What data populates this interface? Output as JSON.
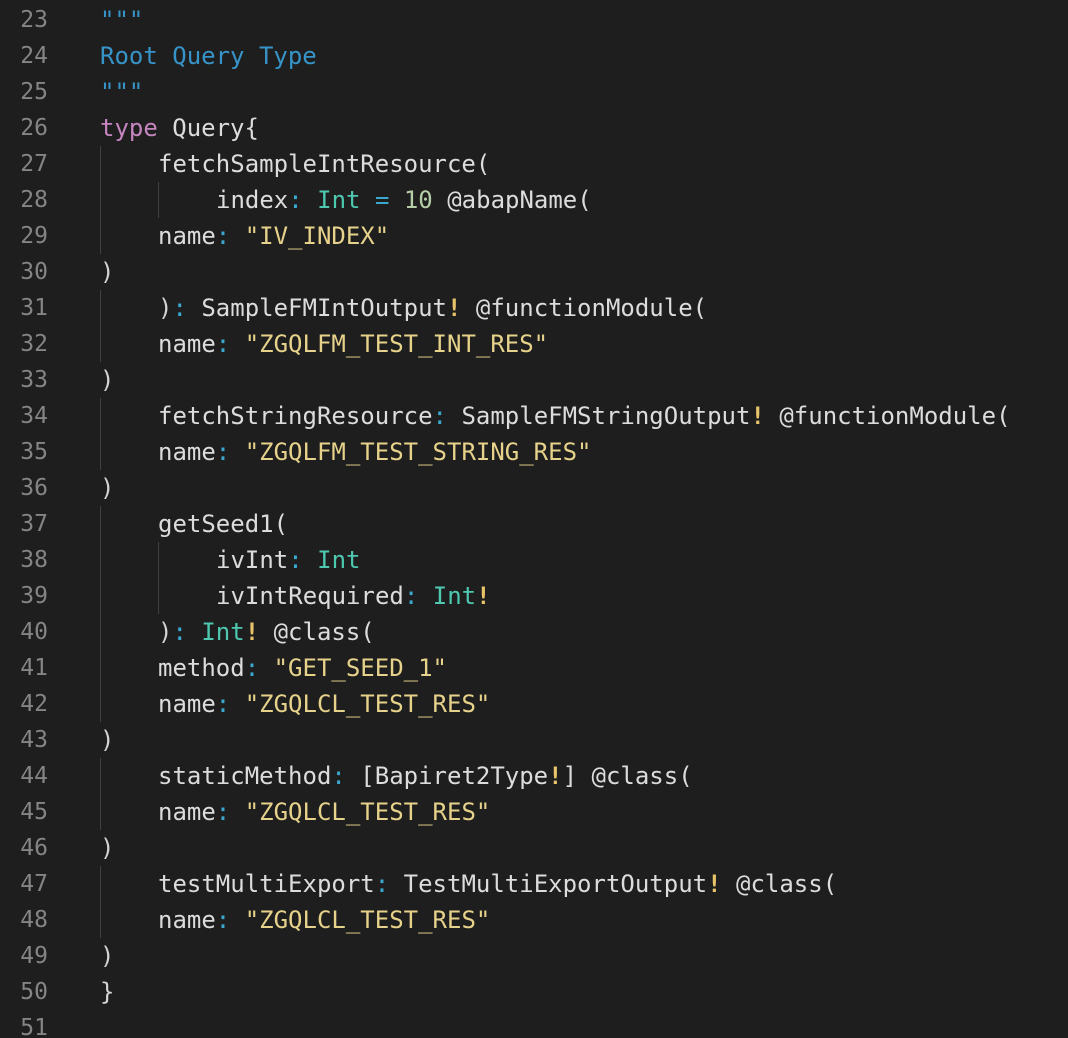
{
  "editor": {
    "lines": [
      {
        "num": "23",
        "indent": 0,
        "tokens": [
          {
            "t": "\"\"\"",
            "c": "doc"
          }
        ]
      },
      {
        "num": "24",
        "indent": 0,
        "tokens": [
          {
            "t": "Root Query Type",
            "c": "doc"
          }
        ]
      },
      {
        "num": "25",
        "indent": 0,
        "tokens": [
          {
            "t": "\"\"\"",
            "c": "doc"
          }
        ]
      },
      {
        "num": "26",
        "indent": 0,
        "tokens": [
          {
            "t": "type",
            "c": "kw"
          },
          {
            "t": " Query{",
            "c": "id"
          }
        ]
      },
      {
        "num": "27",
        "indent": 1,
        "tokens": [
          {
            "t": "fetchSampleIntResource(",
            "c": "id"
          }
        ]
      },
      {
        "num": "28",
        "indent": 2,
        "tokens": [
          {
            "t": "index",
            "c": "id"
          },
          {
            "t": ":",
            "c": "colon"
          },
          {
            "t": " Int",
            "c": "type"
          },
          {
            "t": " = ",
            "c": "colon"
          },
          {
            "t": "10",
            "c": "num"
          },
          {
            "t": " @abapName(",
            "c": "id"
          }
        ]
      },
      {
        "num": "29",
        "indent": 1,
        "tokens": [
          {
            "t": "name",
            "c": "id"
          },
          {
            "t": ":",
            "c": "colon"
          },
          {
            "t": " \"IV_INDEX\"",
            "c": "str"
          }
        ]
      },
      {
        "num": "30",
        "indent": 0,
        "tokens": [
          {
            "t": ")",
            "c": "punct"
          }
        ]
      },
      {
        "num": "31",
        "indent": 1,
        "tokens": [
          {
            "t": ")",
            "c": "punct"
          },
          {
            "t": ":",
            "c": "colon"
          },
          {
            "t": " SampleFMIntOutput",
            "c": "id"
          },
          {
            "t": "!",
            "c": "bang"
          },
          {
            "t": " @functionModule(",
            "c": "id"
          }
        ]
      },
      {
        "num": "32",
        "indent": 1,
        "tokens": [
          {
            "t": "name",
            "c": "id"
          },
          {
            "t": ":",
            "c": "colon"
          },
          {
            "t": " \"ZGQLFM_TEST_INT_RES\"",
            "c": "str"
          }
        ]
      },
      {
        "num": "33",
        "indent": 0,
        "tokens": [
          {
            "t": ")",
            "c": "punct"
          }
        ]
      },
      {
        "num": "34",
        "indent": 1,
        "tokens": [
          {
            "t": "fetchStringResource",
            "c": "id"
          },
          {
            "t": ":",
            "c": "colon"
          },
          {
            "t": " SampleFMStringOutput",
            "c": "id"
          },
          {
            "t": "!",
            "c": "bang"
          },
          {
            "t": " @functionModule(",
            "c": "id"
          }
        ]
      },
      {
        "num": "35",
        "indent": 1,
        "tokens": [
          {
            "t": "name",
            "c": "id"
          },
          {
            "t": ":",
            "c": "colon"
          },
          {
            "t": " \"ZGQLFM_TEST_STRING_RES\"",
            "c": "str"
          }
        ]
      },
      {
        "num": "36",
        "indent": 0,
        "tokens": [
          {
            "t": ")",
            "c": "punct"
          }
        ]
      },
      {
        "num": "37",
        "indent": 1,
        "tokens": [
          {
            "t": "getSeed1(",
            "c": "id"
          }
        ]
      },
      {
        "num": "38",
        "indent": 2,
        "tokens": [
          {
            "t": "ivInt",
            "c": "id"
          },
          {
            "t": ":",
            "c": "colon"
          },
          {
            "t": " Int",
            "c": "type"
          }
        ]
      },
      {
        "num": "39",
        "indent": 2,
        "tokens": [
          {
            "t": "ivIntRequired",
            "c": "id"
          },
          {
            "t": ":",
            "c": "colon"
          },
          {
            "t": " Int",
            "c": "type"
          },
          {
            "t": "!",
            "c": "bang"
          }
        ]
      },
      {
        "num": "40",
        "indent": 1,
        "tokens": [
          {
            "t": ")",
            "c": "punct"
          },
          {
            "t": ":",
            "c": "colon"
          },
          {
            "t": " Int",
            "c": "type"
          },
          {
            "t": "!",
            "c": "bang"
          },
          {
            "t": " @class(",
            "c": "id"
          }
        ]
      },
      {
        "num": "41",
        "indent": 1,
        "tokens": [
          {
            "t": "method",
            "c": "id"
          },
          {
            "t": ":",
            "c": "colon"
          },
          {
            "t": " \"GET_SEED_1\"",
            "c": "str"
          }
        ]
      },
      {
        "num": "42",
        "indent": 1,
        "tokens": [
          {
            "t": "name",
            "c": "id"
          },
          {
            "t": ":",
            "c": "colon"
          },
          {
            "t": " \"ZGQLCL_TEST_RES\"",
            "c": "str"
          }
        ]
      },
      {
        "num": "43",
        "indent": 0,
        "tokens": [
          {
            "t": ")",
            "c": "punct"
          }
        ]
      },
      {
        "num": "44",
        "indent": 1,
        "tokens": [
          {
            "t": "staticMethod",
            "c": "id"
          },
          {
            "t": ":",
            "c": "colon"
          },
          {
            "t": " [Bapiret2Type",
            "c": "id"
          },
          {
            "t": "!",
            "c": "bang"
          },
          {
            "t": "] @class(",
            "c": "id"
          }
        ]
      },
      {
        "num": "45",
        "indent": 1,
        "tokens": [
          {
            "t": "name",
            "c": "id"
          },
          {
            "t": ":",
            "c": "colon"
          },
          {
            "t": " \"ZGQLCL_TEST_RES\"",
            "c": "str"
          }
        ]
      },
      {
        "num": "46",
        "indent": 0,
        "tokens": [
          {
            "t": ")",
            "c": "punct"
          }
        ]
      },
      {
        "num": "47",
        "indent": 1,
        "tokens": [
          {
            "t": "testMultiExport",
            "c": "id"
          },
          {
            "t": ":",
            "c": "colon"
          },
          {
            "t": " TestMultiExportOutput",
            "c": "id"
          },
          {
            "t": "!",
            "c": "bang"
          },
          {
            "t": " @class(",
            "c": "id"
          }
        ]
      },
      {
        "num": "48",
        "indent": 1,
        "tokens": [
          {
            "t": "name",
            "c": "id"
          },
          {
            "t": ":",
            "c": "colon"
          },
          {
            "t": " \"ZGQLCL_TEST_RES\"",
            "c": "str"
          }
        ]
      },
      {
        "num": "49",
        "indent": 0,
        "tokens": [
          {
            "t": ")",
            "c": "punct"
          }
        ]
      },
      {
        "num": "50",
        "indent": 0,
        "tokens": [
          {
            "t": "}",
            "c": "punct"
          }
        ]
      },
      {
        "num": "51",
        "indent": 0,
        "tokens": []
      }
    ]
  },
  "colors": {
    "background": "#1e1e1e",
    "line_number": "#858585",
    "keyword": "#c586c0",
    "doc_comment": "#3794c8",
    "type": "#4ec9b0",
    "string": "#e6d28a",
    "number": "#b5cea8",
    "exclamation": "#e9c46a"
  }
}
